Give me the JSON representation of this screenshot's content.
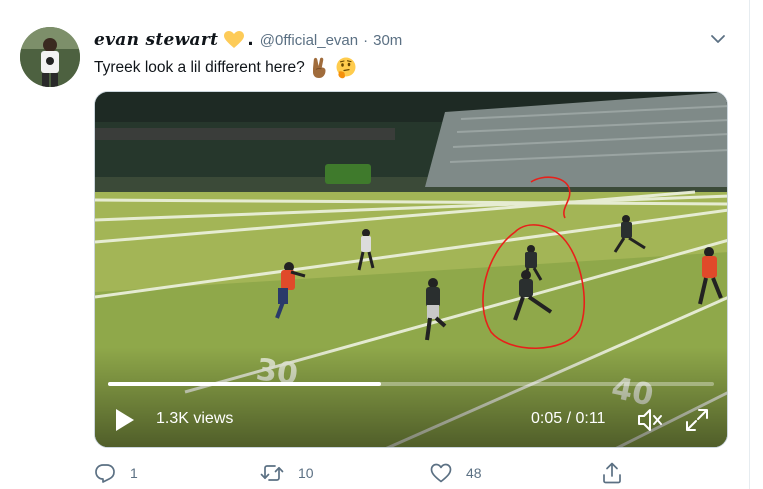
{
  "tweet": {
    "display_name": "evan stewart",
    "handle": "@0fficial_evan",
    "separator": "·",
    "time": "30m",
    "text": "Tyreek look a lil different here?"
  },
  "video": {
    "views": "1.3K views",
    "time": "0:05 / 0:11",
    "progress": 0.45,
    "field_numbers": [
      "30",
      "40"
    ]
  },
  "actions": {
    "reply_count": "1",
    "retweet_count": "10",
    "like_count": "48"
  },
  "icons": {
    "heart_emoji": "yellow-heart",
    "hand_emoji": "victory-hand",
    "face_emoji": "thinking-face",
    "caret": "chevron-down-icon",
    "play": "play-icon",
    "volume": "volume-icon",
    "fullscreen": "fullscreen-icon"
  },
  "colors": {
    "text_primary": "#0f1419",
    "text_secondary": "#5b7083",
    "field_green": "#8fa84a",
    "annotation_red": "#e8201a"
  }
}
